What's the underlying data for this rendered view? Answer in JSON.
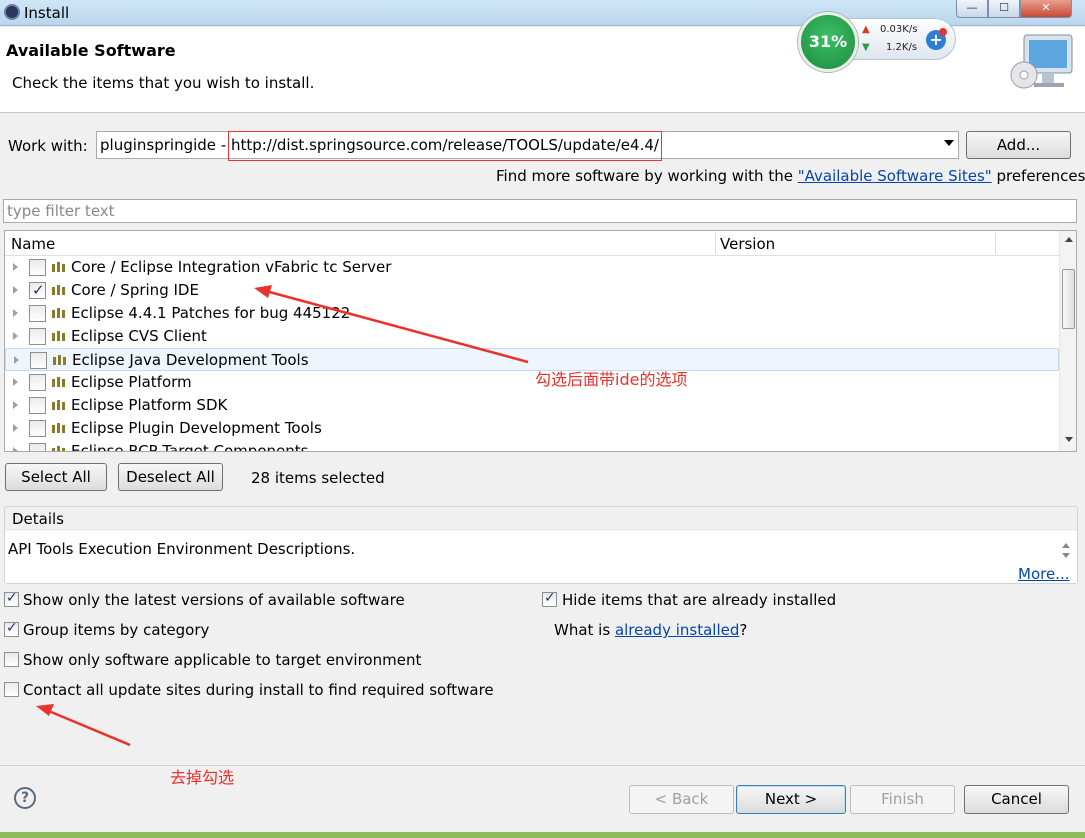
{
  "window": {
    "title": "Install"
  },
  "header": {
    "title": "Available Software",
    "subtitle": "Check the items that you wish to install."
  },
  "speed_widget": {
    "percent": "31%",
    "upload": "0.03K/s",
    "download": "1.2K/s",
    "add_icon": "plus-icon"
  },
  "work_with": {
    "label": "Work with:",
    "value": "pluginspringide - http://dist.springsource.com/release/TOOLS/update/e4.4/",
    "add_label": "Add...",
    "find_more_prefix": "Find more software by working with the ",
    "find_more_link": "\"Available Software Sites\"",
    "find_more_suffix": " preferences."
  },
  "filter": {
    "placeholder": "type filter text",
    "value": ""
  },
  "tree": {
    "columns": [
      "Name",
      "Version"
    ],
    "rows": [
      {
        "label": "Core / Eclipse Integration vFabric tc Server",
        "checked": false
      },
      {
        "label": "Core / Spring IDE",
        "checked": true
      },
      {
        "label": "Eclipse 4.4.1 Patches for bug 445122",
        "checked": false
      },
      {
        "label": "Eclipse CVS Client",
        "checked": false
      },
      {
        "label": "Eclipse Java Development Tools",
        "checked": false
      },
      {
        "label": "Eclipse Platform",
        "checked": false
      },
      {
        "label": "Eclipse Platform SDK",
        "checked": false
      },
      {
        "label": "Eclipse Plugin Development Tools",
        "checked": false
      },
      {
        "label": "Eclipse RCP Target Components",
        "checked": false
      }
    ]
  },
  "selection": {
    "select_all": "Select All",
    "deselect_all": "Deselect All",
    "count_text": "28 items selected"
  },
  "details": {
    "label": "Details",
    "text": "API Tools Execution Environment Descriptions.",
    "more_link": "More..."
  },
  "options": {
    "latest_versions": {
      "label": "Show only the latest versions of available software",
      "checked": true
    },
    "group_by_category": {
      "label": "Group items by category",
      "checked": true
    },
    "target_env": {
      "label": "Show only software applicable to target environment",
      "checked": false
    },
    "contact_sites": {
      "label": "Contact all update sites during install to find required software",
      "checked": false
    },
    "hide_installed": {
      "label": "Hide items that are already installed",
      "checked": true
    },
    "what_is_prefix": "What is ",
    "what_is_link": "already installed",
    "what_is_suffix": "?"
  },
  "annotations": {
    "ide_note": "勾选后面带ide的选项",
    "uncheck_note": "去掉勾选",
    "color": "#e8322b"
  },
  "footer": {
    "help": "?",
    "back": "< Back",
    "next": "Next >",
    "finish": "Finish",
    "cancel": "Cancel"
  }
}
